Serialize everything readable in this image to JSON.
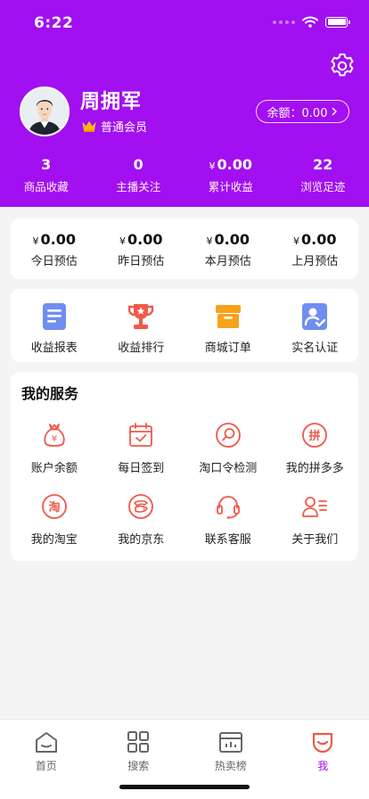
{
  "status_bar": {
    "time": "6:22"
  },
  "profile": {
    "name": "周拥军",
    "member_level": "普通会员",
    "balance_label": "余额：0.00"
  },
  "stats": [
    {
      "value": "3",
      "label": "商品收藏"
    },
    {
      "value": "0",
      "label": "主播关注"
    },
    {
      "currency": "¥",
      "value": "0.00",
      "label": "累计收益"
    },
    {
      "value": "22",
      "label": "浏览足迹"
    }
  ],
  "estimates": [
    {
      "currency": "¥",
      "value": "0.00",
      "label": "今日预估"
    },
    {
      "currency": "¥",
      "value": "0.00",
      "label": "昨日预估"
    },
    {
      "currency": "¥",
      "value": "0.00",
      "label": "本月预估"
    },
    {
      "currency": "¥",
      "value": "0.00",
      "label": "上月预估"
    }
  ],
  "quick_actions": [
    {
      "label": "收益报表",
      "icon": "report-icon"
    },
    {
      "label": "收益排行",
      "icon": "trophy-icon"
    },
    {
      "label": "商城订单",
      "icon": "order-box-icon"
    },
    {
      "label": "实名认证",
      "icon": "id-verify-icon"
    }
  ],
  "services": {
    "title": "我的服务",
    "items": [
      {
        "label": "账户余额",
        "icon": "money-bag-icon"
      },
      {
        "label": "每日签到",
        "icon": "calendar-check-icon"
      },
      {
        "label": "淘口令检测",
        "icon": "magnifier-icon"
      },
      {
        "label": "我的拼多多",
        "icon": "pinduoduo-icon",
        "glyph": "拼"
      },
      {
        "label": "我的淘宝",
        "icon": "taobao-icon",
        "glyph": "淘"
      },
      {
        "label": "我的京东",
        "icon": "jd-icon"
      },
      {
        "label": "联系客服",
        "icon": "headset-icon"
      },
      {
        "label": "关于我们",
        "icon": "about-us-icon"
      }
    ]
  },
  "tabbar": [
    {
      "label": "首页",
      "icon": "home-icon",
      "active": false
    },
    {
      "label": "搜索",
      "icon": "grid-icon",
      "active": false
    },
    {
      "label": "热卖榜",
      "icon": "ranking-icon",
      "active": false
    },
    {
      "label": "我",
      "icon": "profile-smile-icon",
      "active": true
    }
  ],
  "colors": {
    "brand_purple": "#a20ff0",
    "service_red": "#f0584a",
    "blue_icon": "#6f8ef0",
    "orange_icon": "#f7a21b",
    "red_icon": "#f05a4a"
  }
}
